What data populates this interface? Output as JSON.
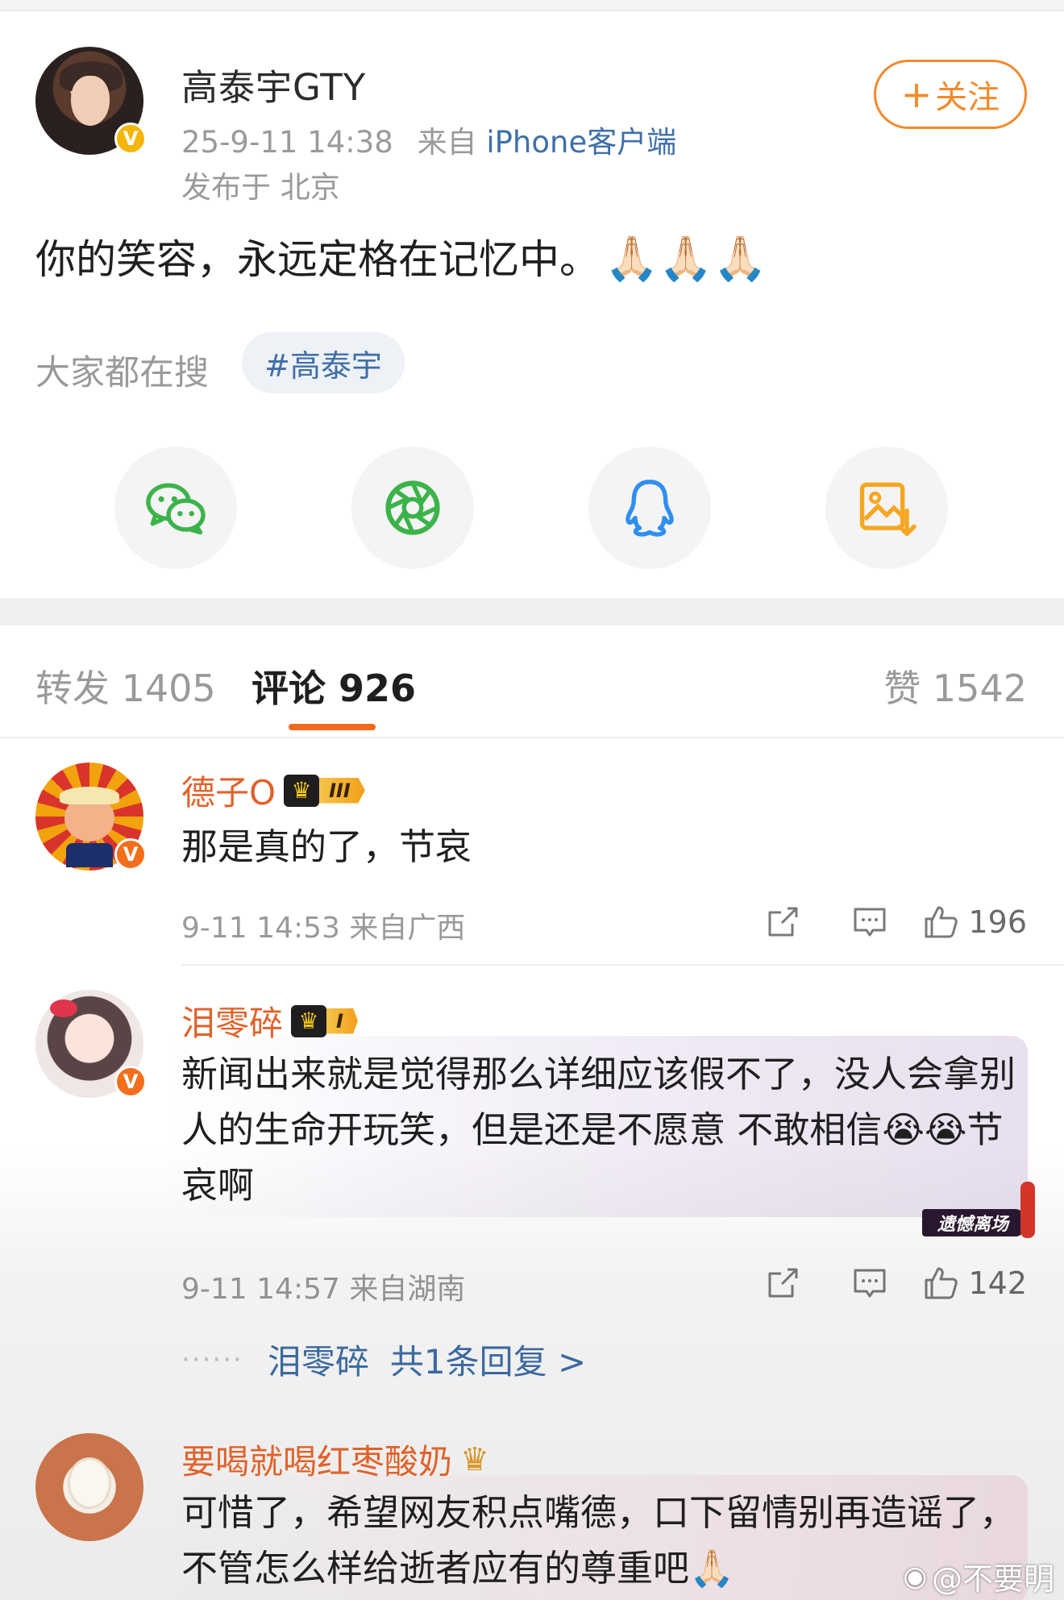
{
  "post": {
    "author": "高泰宇GTY",
    "date": "25-9-11 14:38",
    "from_prefix": "来自",
    "client": "iPhone客户端",
    "location": "发布于 北京",
    "follow_label": "关注",
    "text": "你的笑容，永远定格在记忆中。",
    "text_emoji": "🙏🏻🙏🏻🙏🏻"
  },
  "search": {
    "label": "大家都在搜",
    "topic": "#高泰宇"
  },
  "share": {
    "icons": [
      "wechat-icon",
      "moments-icon",
      "qq-icon",
      "save-image-icon"
    ]
  },
  "tabs": {
    "repost": "转发 1405",
    "comments": "评论 926",
    "likes": "赞 1542"
  },
  "comments": [
    {
      "name": "德子O",
      "level": "III",
      "text": "那是真的了，节哀",
      "meta": "9-11 14:53  来自广西",
      "likes": "196"
    },
    {
      "name": "泪零碎",
      "level": "I",
      "text": "新闻出来就是觉得那么详细应该假不了，没人会拿别人的生命开玩笑，但是还是不愿意 不敢相信",
      "text_emoji": "😭😭",
      "text_tail": "节哀啊",
      "meta": "9-11 14:57  来自湖南",
      "likes": "142",
      "card_tag": "遗憾离场",
      "reply_user": "泪零碎",
      "reply_count": "共1条回复 >"
    },
    {
      "name": "要喝就喝红枣酸奶",
      "text": "可惜了，希望网友积点嘴德，口下留情别再造谣了，不管怎么样给逝者应有的尊重吧",
      "text_emoji": "🙏🏻"
    }
  ],
  "watermark": "@不要明",
  "colors": {
    "accent_orange": "#f28a2b",
    "name_orange": "#e0622a",
    "link_blue": "#3f6fa8",
    "tab_underline": "#f26a1c"
  }
}
